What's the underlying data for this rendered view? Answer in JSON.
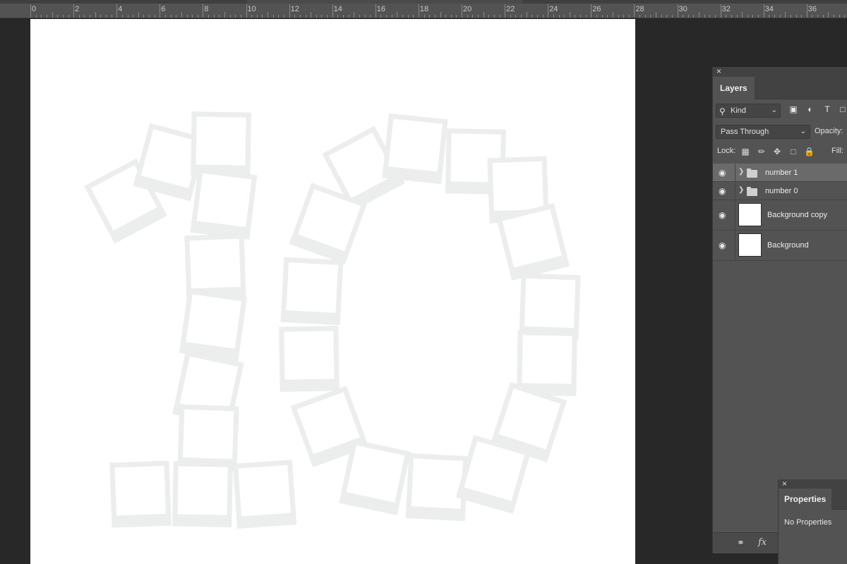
{
  "ruler": {
    "labels": [
      "0",
      "2",
      "4",
      "6",
      "8",
      "10",
      "12",
      "14",
      "16",
      "18",
      "20",
      "22",
      "24",
      "26",
      "28",
      "30",
      "32",
      "34",
      "36"
    ]
  },
  "layers_panel": {
    "close": "×",
    "tab": "Layers",
    "filter_kind": "Kind",
    "blend_mode": "Pass Through",
    "opacity_label": "Opacity:",
    "lock_label": "Lock:",
    "fill_label": "Fill:",
    "layers": [
      {
        "name": "number 1",
        "type": "group"
      },
      {
        "name": "number 0",
        "type": "group"
      },
      {
        "name": "Background copy",
        "type": "image"
      },
      {
        "name": "Background",
        "type": "image"
      }
    ],
    "footer": {
      "fx": "fx"
    }
  },
  "properties_panel": {
    "close": "×",
    "tab": "Properties",
    "message": "No Properties"
  },
  "canvas": {
    "background": "#ffffff",
    "frame_color": "#eceded"
  }
}
